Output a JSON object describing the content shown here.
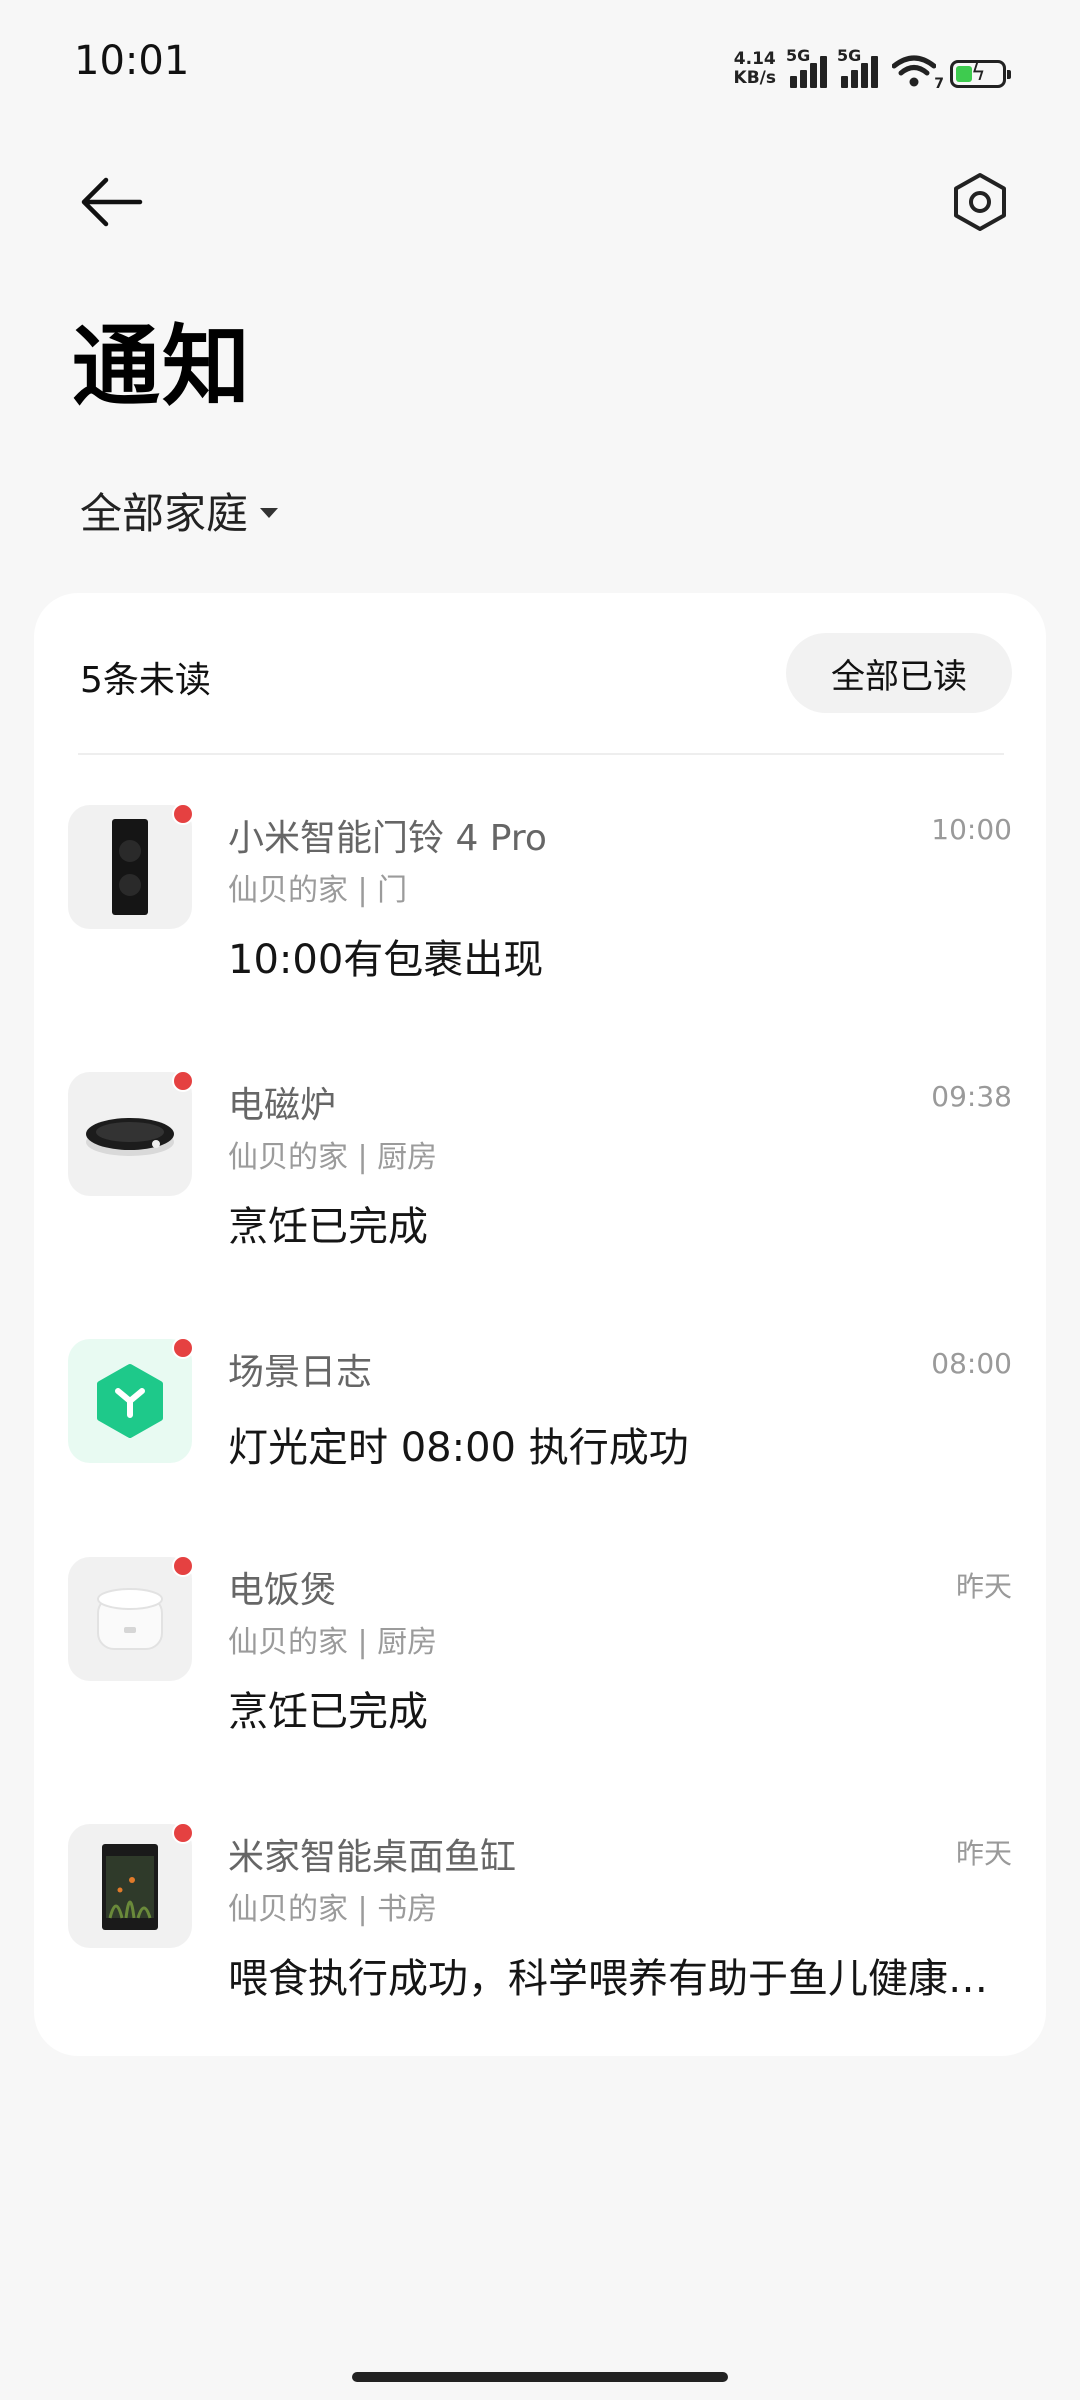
{
  "status": {
    "time": "10:01",
    "speed_value": "4.14",
    "speed_unit": "KB/s",
    "signal1_label": "5G",
    "signal2_label": "5G",
    "wifi_label": "7"
  },
  "header": {
    "title": "通知",
    "filter_label": "全部家庭"
  },
  "card": {
    "unread_label": "5条未读",
    "read_all_label": "全部已读",
    "items": [
      {
        "name": "小米智能门铃 4 Pro",
        "time": "10:00",
        "location": "仙贝的家 | 门",
        "message": "10:00有包裹出现",
        "icon": "doorbell-icon",
        "unread": true
      },
      {
        "name": "电磁炉",
        "time": "09:38",
        "location": "仙贝的家 | 厨房",
        "message": "烹饪已完成",
        "icon": "induction-cooker-icon",
        "unread": true
      },
      {
        "name": "场景日志",
        "time": "08:00",
        "location": "",
        "message": "灯光定时 08:00 执行成功",
        "icon": "scene-log-icon",
        "unread": true
      },
      {
        "name": "电饭煲",
        "time": "昨天",
        "location": "仙贝的家 | 厨房",
        "message": "烹饪已完成",
        "icon": "rice-cooker-icon",
        "unread": true
      },
      {
        "name": "米家智能桌面鱼缸",
        "time": "昨天",
        "location": "仙贝的家 | 书房",
        "message": "喂食执行成功，科学喂养有助于鱼儿健康成长",
        "icon": "fish-tank-icon",
        "unread": true
      }
    ]
  },
  "colors": {
    "unread_dot": "#e54141",
    "scene_icon_green": "#1ec98a"
  }
}
